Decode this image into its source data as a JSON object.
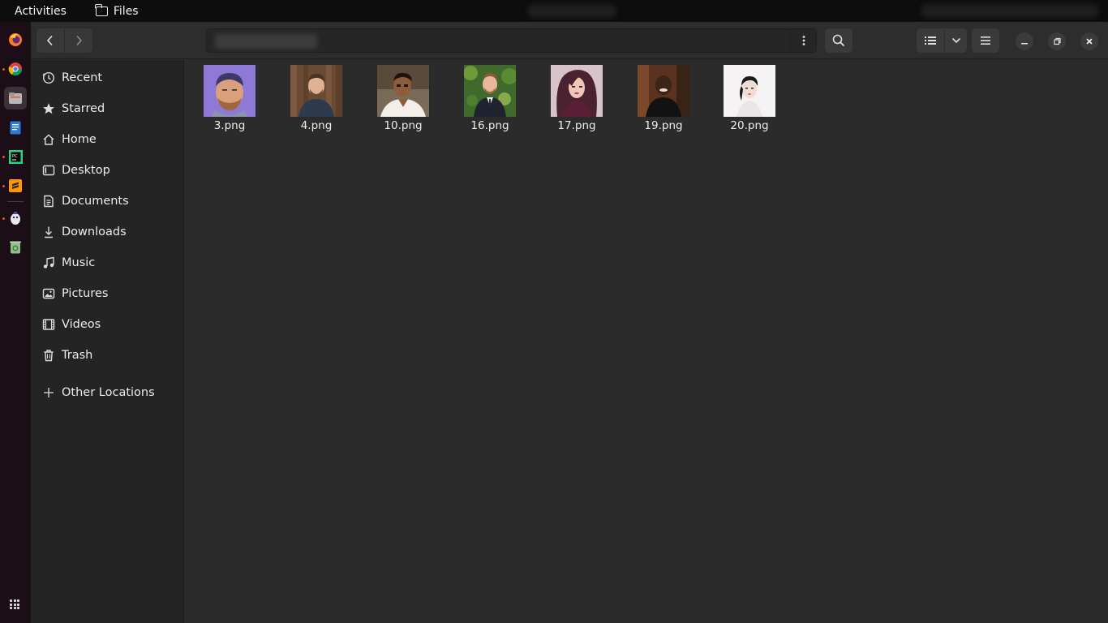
{
  "topbar": {
    "activities_label": "Activities",
    "app_name": "Files"
  },
  "header": {
    "path_placeholder": ""
  },
  "sidebar": {
    "items": [
      {
        "label": "Recent",
        "icon": "clock-icon"
      },
      {
        "label": "Starred",
        "icon": "star-icon"
      },
      {
        "label": "Home",
        "icon": "home-icon"
      },
      {
        "label": "Desktop",
        "icon": "desktop-icon"
      },
      {
        "label": "Documents",
        "icon": "document-icon"
      },
      {
        "label": "Downloads",
        "icon": "download-icon"
      },
      {
        "label": "Music",
        "icon": "music-icon"
      },
      {
        "label": "Pictures",
        "icon": "picture-icon"
      },
      {
        "label": "Videos",
        "icon": "video-icon"
      },
      {
        "label": "Trash",
        "icon": "trash-icon"
      }
    ],
    "other_locations": "Other Locations"
  },
  "files": [
    {
      "name": "3.png",
      "thumb": "avatar-cartoon"
    },
    {
      "name": "4.png",
      "thumb": "photo-man-wood"
    },
    {
      "name": "10.png",
      "thumb": "photo-man-white"
    },
    {
      "name": "16.png",
      "thumb": "photo-man-suit"
    },
    {
      "name": "17.png",
      "thumb": "photo-woman"
    },
    {
      "name": "19.png",
      "thumb": "photo-man-dark"
    },
    {
      "name": "20.png",
      "thumb": "photo-woman-light"
    }
  ],
  "colors": {
    "accent": "#e95420",
    "background": "#2b2b2b",
    "sidebar": "#242424"
  }
}
